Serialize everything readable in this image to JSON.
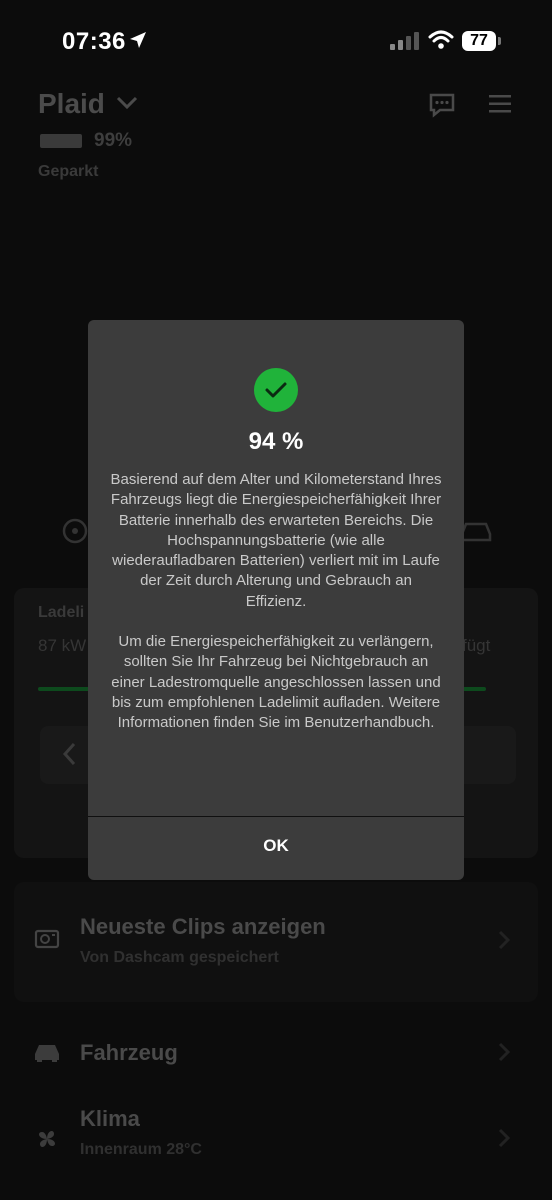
{
  "status_bar": {
    "time": "07:36",
    "battery": "77"
  },
  "header": {
    "car_name": "Plaid",
    "battery_percent": "99%",
    "state": "Geparkt"
  },
  "charging": {
    "title": "Ladeli",
    "energy": "87 kW",
    "added": "fügt"
  },
  "clips": {
    "title": "Neueste Clips anzeigen",
    "subtitle": "Von Dashcam gespeichert"
  },
  "menu": {
    "vehicle": "Fahrzeug",
    "climate": {
      "title": "Klima",
      "subtitle": "Innenraum 28°C"
    }
  },
  "dialog": {
    "percent": "94 %",
    "paragraph1": "Basierend auf dem Alter und Kilometerstand Ihres Fahrzeugs liegt die Energiespeicherfähigkeit Ihrer Batterie innerhalb des erwarteten Bereichs. Die Hochspannungsbatterie (wie alle wiederaufladbaren Batterien) verliert mit im Laufe der Zeit durch Alterung und Gebrauch an Effizienz.",
    "paragraph2": "Um die Energiespeicherfähigkeit zu verlängern, sollten Sie Ihr Fahrzeug bei Nichtgebrauch an einer Ladestromquelle angeschlossen lassen und bis zum empfohlenen Ladelimit aufladen. Weitere Informationen finden Sie im Benutzerhandbuch.",
    "ok_label": "OK"
  },
  "colors": {
    "success": "#20b33a",
    "dialog_bg": "#3c3c3c"
  }
}
